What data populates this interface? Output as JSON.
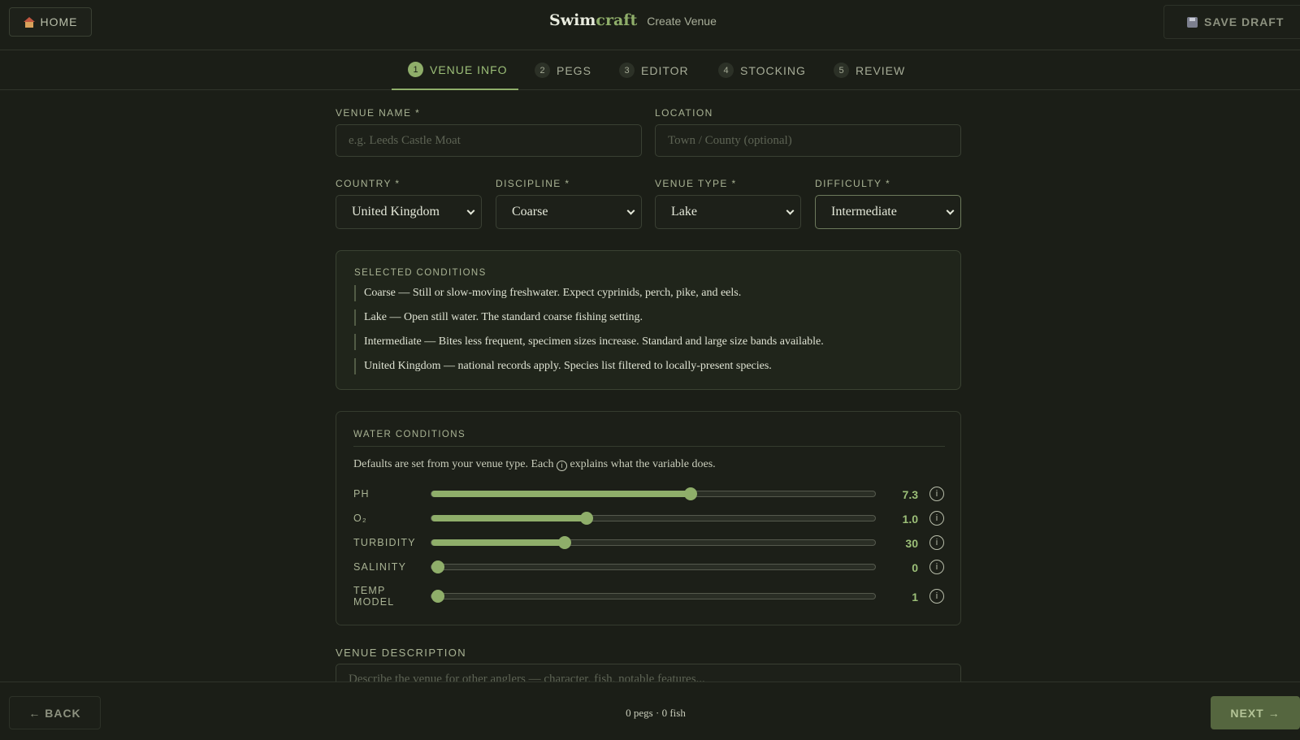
{
  "header": {
    "home_label": "HOME",
    "brand_left": "Swim",
    "brand_right": "craft",
    "subtitle": "Create Venue",
    "save_draft_label": "SAVE DRAFT"
  },
  "steps": [
    {
      "num": "1",
      "label": "VENUE INFO",
      "active": true
    },
    {
      "num": "2",
      "label": "PEGS"
    },
    {
      "num": "3",
      "label": "EDITOR"
    },
    {
      "num": "4",
      "label": "STOCKING"
    },
    {
      "num": "5",
      "label": "REVIEW"
    }
  ],
  "form": {
    "venue_name_label": "VENUE NAME *",
    "venue_name_placeholder": "e.g. Leeds Castle Moat",
    "location_label": "LOCATION",
    "location_placeholder": "Town / County (optional)",
    "country_label": "COUNTRY *",
    "country_value": "United Kingdom",
    "discipline_label": "DISCIPLINE *",
    "discipline_value": "Coarse",
    "venue_type_label": "VENUE TYPE *",
    "venue_type_value": "Lake",
    "difficulty_label": "DIFFICULTY *",
    "difficulty_value": "Intermediate",
    "description_label": "VENUE DESCRIPTION",
    "description_placeholder": "Describe the venue for other anglers — character, fish, notable features..."
  },
  "conditions": {
    "title": "SELECTED CONDITIONS",
    "items": [
      "Coarse — Still or slow-moving freshwater. Expect cyprinids, perch, pike, and eels.",
      "Lake — Open still water. The standard coarse fishing setting.",
      "Intermediate — Bites less frequent, specimen sizes increase. Standard and large size bands available.",
      "United Kingdom — national records apply. Species list filtered to locally-present species."
    ]
  },
  "water": {
    "title": "WATER CONDITIONS",
    "desc_before": "Defaults are set from your venue type. Each",
    "desc_icon": "i",
    "desc_after": "explains what the variable does.",
    "info_icon": "info-icon",
    "sliders": [
      {
        "label": "PH",
        "value": "7.3",
        "fraction": 0.585
      },
      {
        "label": "O₂",
        "value": "1.0",
        "fraction": 0.35
      },
      {
        "label": "TURBIDITY",
        "value": "30",
        "fraction": 0.3
      },
      {
        "label": "SALINITY",
        "value": "0",
        "fraction": 0.0
      },
      {
        "label": "TEMP MODEL",
        "label_line1": "TEMP",
        "label_line2": "MODEL",
        "value": "1",
        "fraction": 0.0
      }
    ]
  },
  "footer": {
    "back_label": "← BACK",
    "status": "0 pegs · 0 fish",
    "next_label": "NEXT →"
  },
  "colors": {
    "accent": "#8fae6a",
    "background": "#1b1e17",
    "panel": "#20251b"
  }
}
